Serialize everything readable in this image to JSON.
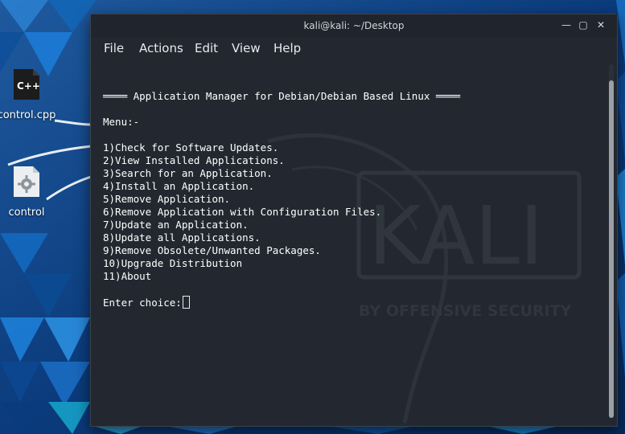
{
  "desktop": {
    "icons": [
      {
        "name": "control.cpp",
        "icon": "cpp-file-icon"
      },
      {
        "name": "control",
        "icon": "executable-gear-icon"
      }
    ]
  },
  "window": {
    "title": "kali@kali: ~/Desktop",
    "controls": [
      "minimize-icon",
      "maximize-icon",
      "close-icon"
    ],
    "menu": [
      "File",
      "Actions",
      "Edit",
      "View",
      "Help"
    ]
  },
  "terminal": {
    "lines": [
      "════ Application Manager for Debian/Debian Based Linux ════",
      "Menu:-",
      "1)Check for Software Updates.",
      "2)View Installed Applications.",
      "3)Search for an Application.",
      "4)Install an Application.",
      "5)Remove Application.",
      "6)Remove Application with Configuration Files.",
      "7)Update an Application.",
      "8)Update all Applications.",
      "9)Remove Obsolete/Unwanted Packages.",
      "10)Upgrade Distribution",
      "11)About",
      "Enter choice:"
    ],
    "watermark_title": "KALI",
    "watermark_sub": "BY OFFENSIVE SECURITY"
  },
  "colors": {
    "terminal_bg": "#232830",
    "text": "#ffffff",
    "titlebar": "#20252d"
  }
}
